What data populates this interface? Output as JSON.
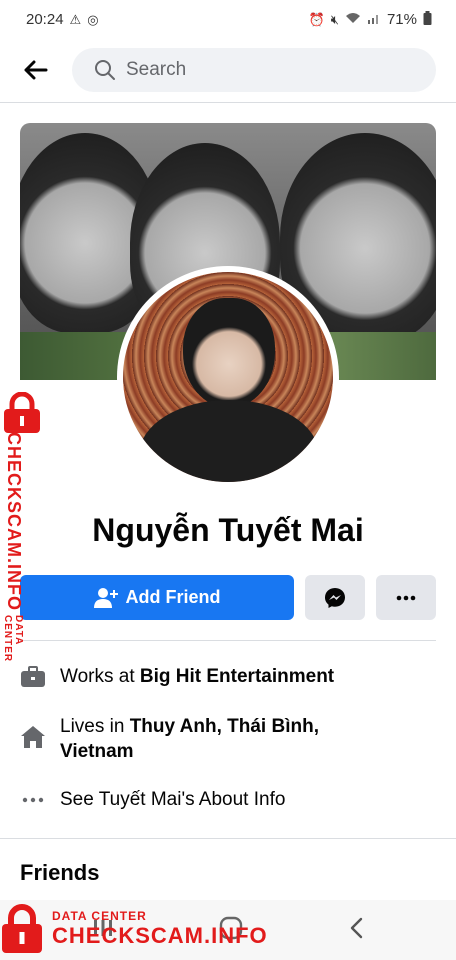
{
  "status_bar": {
    "time": "20:24",
    "battery": "71%",
    "left_icons": [
      "alert-icon",
      "instagram-icon"
    ],
    "right_icons": [
      "alarm-icon",
      "mute-icon",
      "wifi-icon",
      "signal-icon",
      "battery-icon"
    ]
  },
  "topbar": {
    "search_placeholder": "Search"
  },
  "profile": {
    "name": "Nguyễn Tuyết Mai"
  },
  "actions": {
    "add_friend": "Add Friend"
  },
  "info": {
    "work_prefix": "Works at ",
    "work_place": "Big Hit Entertainment",
    "lives_prefix": "Lives in ",
    "lives_place_1": "Thuy Anh, Thái Bình,",
    "lives_place_2": "Vietnam",
    "about": "See Tuyết Mai's About Info"
  },
  "friends": {
    "title": "Friends"
  },
  "watermark": {
    "small": "DATA CENTER",
    "big": "CHECKSCAM.INFO"
  },
  "colors": {
    "accent": "#1877f2",
    "watermark": "#e21b1b"
  }
}
